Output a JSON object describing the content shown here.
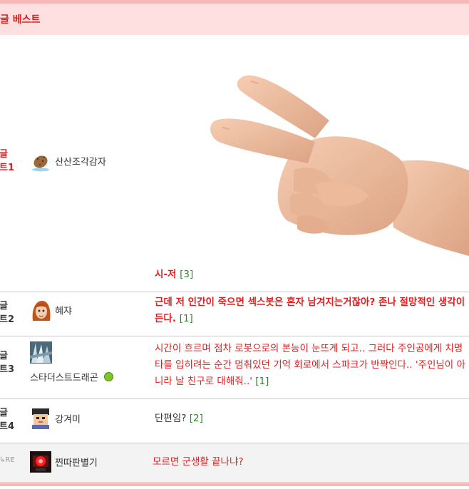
{
  "header": {
    "title": "글 베스트"
  },
  "rows": [
    {
      "rank": "글\n트1",
      "user": "산산조각감자",
      "title": "시-저",
      "count": "[3]"
    },
    {
      "rank": "글\n트2",
      "user": "혜쟈",
      "title": "근데 저 인간이 죽으면 섹스봇은 혼자 남겨지는거잖아? 존나 절망적인 생각이 든다.",
      "count": "[1]"
    },
    {
      "rank": "글\n트3",
      "user": "스타더스트드래곤",
      "title": "시간이 흐르며 점차 로봇으로의 본능이 눈뜨게 되고.. 그러다 주인공에게 치명타를 입히려는 순간 멈춰있던 기억 회로에서 스파크가 반짝인다.. '주인님이 아니라 날 친구로 대해줘..'",
      "count": "[1]"
    },
    {
      "rank": "글\n트4",
      "user": "강겨미",
      "title": "단편임?",
      "count": "[2]"
    },
    {
      "rank": "RE",
      "user": "찐따판별기",
      "title": "모르면 군생활 끝나냐?",
      "count": ""
    }
  ],
  "colors": {
    "accent": "#e02020",
    "header_bg": "#ffe0e0",
    "count": "#2a8a2a"
  }
}
